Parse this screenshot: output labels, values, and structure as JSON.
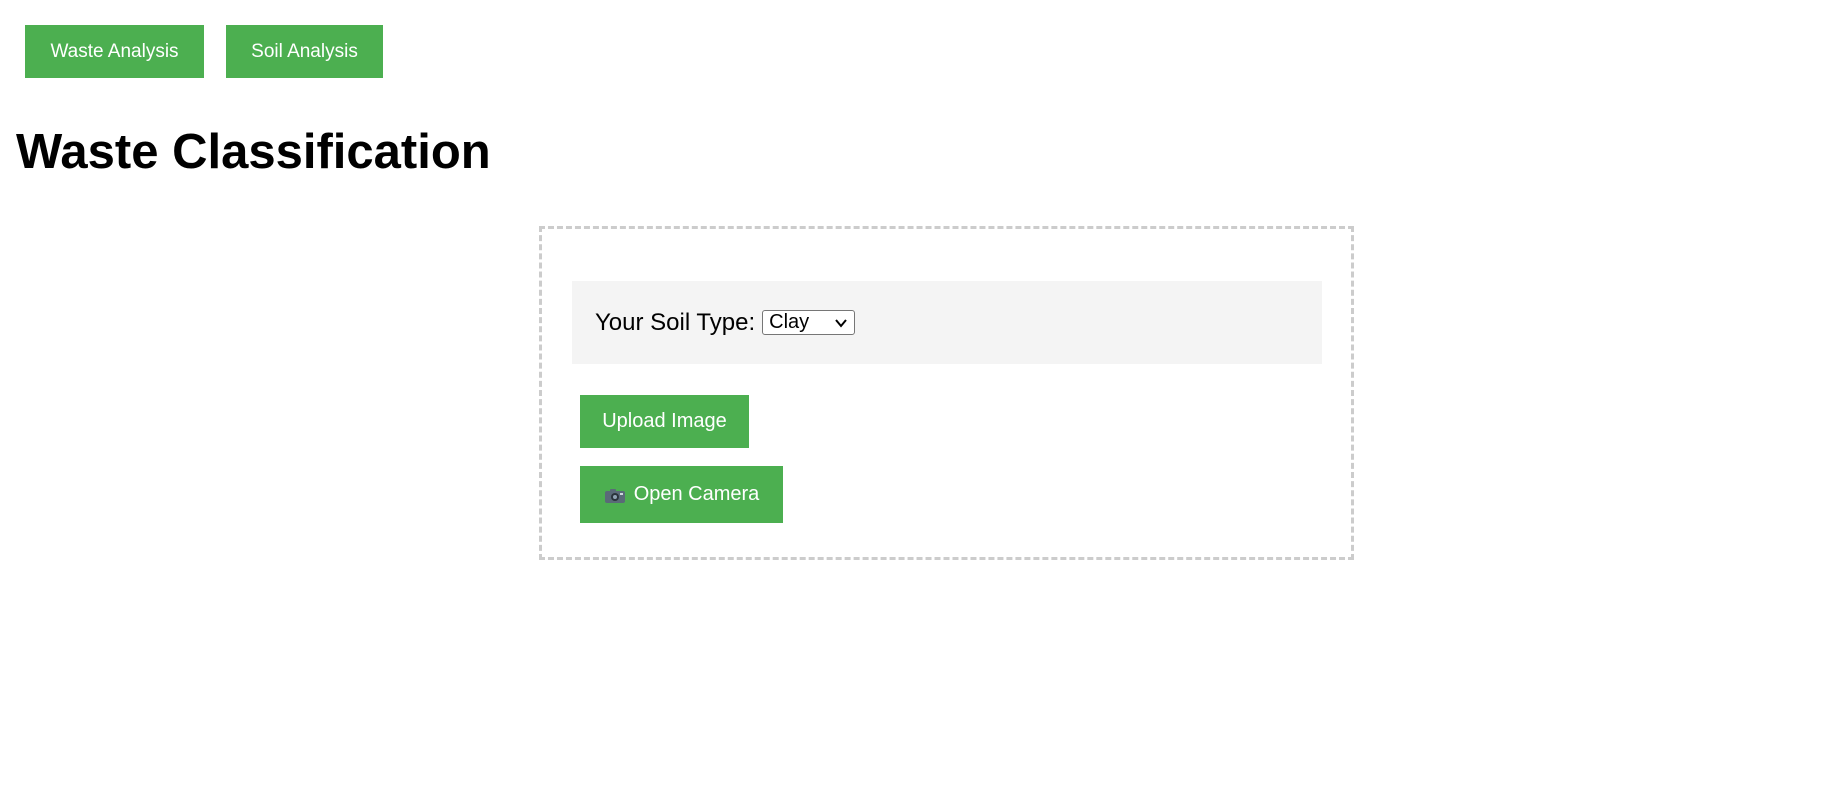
{
  "nav": {
    "waste_label": "Waste Analysis",
    "soil_label": "Soil Analysis"
  },
  "page": {
    "title": "Waste Classification"
  },
  "upload": {
    "soil_type_label": "Your Soil Type:",
    "soil_type_selected": "Clay",
    "upload_label": "Upload Image",
    "camera_label": "Open Camera",
    "camera_icon": "camera-icon"
  },
  "colors": {
    "accent": "#4caf50",
    "panel_bg": "#f4f4f4",
    "dashed_border": "#cccccc"
  }
}
